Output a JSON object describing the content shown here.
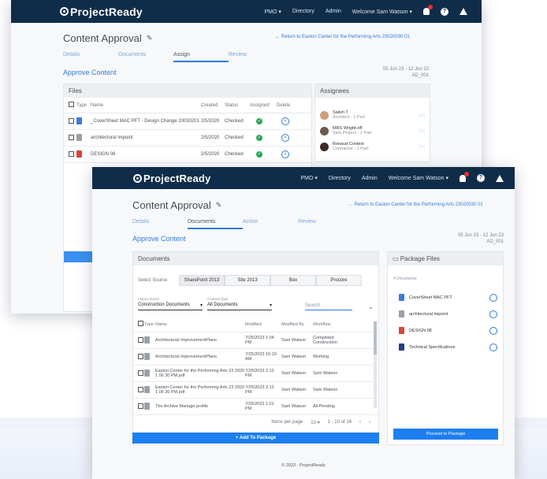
{
  "app": {
    "logo": "ProjectReady",
    "nav": {
      "pmo": "PMO",
      "directory": "Directory",
      "admin": "Admin",
      "welcome": "Welcome Sam Watson"
    }
  },
  "back_window": {
    "title": "Content Approval",
    "return_link": "Return to Easton Center for the Performing Arts 23020030 01",
    "tabs": [
      "Details",
      "Documents",
      "Assign",
      "Review"
    ],
    "active_tab": "Assign",
    "subheading": "Approve Content",
    "meta": [
      "05 Jun 23 - 12 Jun 23",
      "AD_001"
    ],
    "files": {
      "title": "Files",
      "columns": [
        "Type",
        "Name",
        "Created",
        "Status",
        "Assigned",
        "Delete"
      ],
      "rows": [
        {
          "name": "_CoverSheet MAC PFT - Design Change 20030201",
          "created": "2/5/2020",
          "status": "Checked"
        },
        {
          "name": "architectural impoint",
          "created": "2/5/2020",
          "status": "Checked"
        },
        {
          "name": "DESIGN 08",
          "created": "2/5/2020",
          "status": "Checked"
        }
      ]
    },
    "assignees": {
      "title": "Assignees",
      "people": [
        {
          "name": "Salish T",
          "role": "Architect - 1 Part"
        },
        {
          "name": "MRS Wright-off",
          "role": "Sam Project - 1 Part"
        },
        {
          "name": "Renaud Context",
          "role": "Contractor - 1 Part"
        }
      ]
    }
  },
  "front_window": {
    "title": "Content Approval",
    "return_link": "Return to Easton Center for the Performing Arts 23020030 01",
    "tabs": [
      "Details",
      "Documents",
      "Action",
      "Review"
    ],
    "active_tab": "Documents",
    "subheading": "Approve Content",
    "meta": [
      "05 Jun 23 - 12 Jun 23",
      "AD_001"
    ],
    "documents": {
      "title": "Documents",
      "select_source_label": "Select Source",
      "sources": [
        "SharePoint 2013",
        "Site 2013",
        "Box",
        "Procore"
      ],
      "selected_source": "SharePoint 2013",
      "filter1": {
        "label": "Library Name",
        "value": "Construction Documents"
      },
      "filter2": {
        "label": "Content Type",
        "value": "All Documents"
      },
      "search_placeholder": "Search",
      "columns": [
        "Type",
        "Name",
        "Modified",
        "Modified By",
        "Workflow"
      ],
      "rows": [
        {
          "name": "Architectural ImprovementPlans",
          "modified": "7/25/2023 1:04 PM",
          "by": "Sam Watson",
          "wf": "Completed Construction"
        },
        {
          "name": "Architectural ImprovementPlans",
          "modified": "7/25/2023 10:19 AM",
          "by": "Sam Watson",
          "wf": "Working"
        },
        {
          "name": "Easton Center for the Performing Arts 23 2020 1 06 30 PM.pdf",
          "modified": "7/25/2023 2:12 PM",
          "by": "Sam Watson",
          "wf": "Sam Watson"
        },
        {
          "name": "Easton Center for the Performing Arts 23 2020 1 06 30 PM.pdf",
          "modified": "7/25/2023 2:12 PM",
          "by": "Sam Watson",
          "wf": "Sam Watson"
        },
        {
          "name": "The Archive Manage profile",
          "modified": "7/25/2023 1:01 PM",
          "by": "Sam Watson",
          "wf": "All Pending"
        }
      ],
      "items_per_page_label": "Items per page",
      "items_per_page": "10",
      "range": "1 - 10 of 18",
      "add_button": "+ Add To Package"
    },
    "package": {
      "title": "Package Files",
      "count": "4 Documents",
      "items": [
        "CoverSheet MAC PFT",
        "architectural impoint",
        "DESIGN 08",
        "Technical Specifications"
      ],
      "proceed": "Proceed to Package"
    },
    "footer": "© 2023 - ProjectReady"
  },
  "colors": {
    "topbar": "#0f2d49",
    "accent": "#2f7bd8",
    "button": "#1d7ff0",
    "check": "#2aa85a"
  }
}
